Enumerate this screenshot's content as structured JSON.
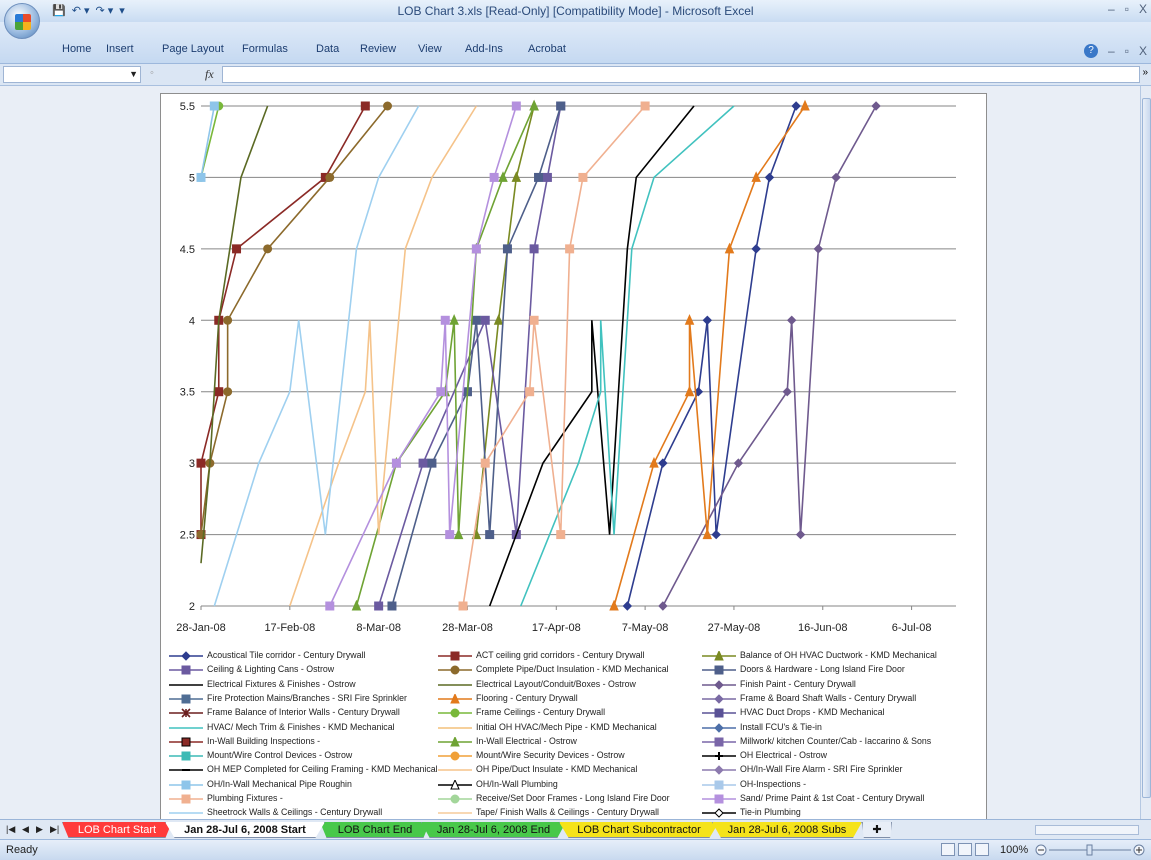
{
  "window": {
    "title": "LOB Chart 3.xls  [Read-Only]  [Compatibility Mode] - Microsoft Excel",
    "controls": [
      "–",
      "▫",
      "X"
    ]
  },
  "quick_access": {
    "save_icon": "save-icon",
    "undo_icon": "undo-icon",
    "redo_icon": "redo-icon"
  },
  "ribbon": {
    "tabs": [
      "Home",
      "Insert",
      "Page Layout",
      "Formulas",
      "Data",
      "Review",
      "View",
      "Add-Ins",
      "Acrobat"
    ]
  },
  "formula_bar": {
    "name_box": "",
    "fx": "fx",
    "formula": ""
  },
  "chart_data": {
    "type": "line",
    "x_axis_type": "date",
    "x_ticks": [
      "28-Jan-08",
      "17-Feb-08",
      "8-Mar-08",
      "28-Mar-08",
      "17-Apr-08",
      "7-May-08",
      "27-May-08",
      "16-Jun-08",
      "6-Jul-08"
    ],
    "y_ticks": [
      "2",
      "2.5",
      "3",
      "3.5",
      "4",
      "4.5",
      "5",
      "5.5"
    ],
    "ylim": [
      2,
      5.5
    ],
    "grid": "horizontal",
    "legend_position": "bottom",
    "series": [
      {
        "name": "Acoustical Tile corridor - Century Drywall",
        "color": "#2e3d8f",
        "marker": "diamond",
        "points": [
          [
            "2008-05-03",
            2
          ],
          [
            "2008-05-11",
            3
          ],
          [
            "2008-05-19",
            3.5
          ],
          [
            "2008-05-21",
            4
          ],
          [
            "2008-05-23",
            2.5
          ],
          [
            "2008-06-01",
            4.5
          ],
          [
            "2008-06-04",
            5
          ],
          [
            "2008-06-10",
            5.5
          ]
        ]
      },
      {
        "name": "ACT ceiling grid corridors - Century Drywall",
        "color": "#8b2a26",
        "marker": "square",
        "points": [
          [
            "2008-01-28",
            2.5
          ],
          [
            "2008-01-28",
            3
          ],
          [
            "2008-02-01",
            3.5
          ],
          [
            "2008-02-01",
            4
          ],
          [
            "2008-02-05",
            4.5
          ],
          [
            "2008-02-25",
            5
          ],
          [
            "2008-03-05",
            5.5
          ]
        ]
      },
      {
        "name": "Balance of OH HVAC Ductwork - KMD Mechanical",
        "color": "#7a8a22",
        "marker": "triangle",
        "points": [
          [
            "2008-03-30",
            2.5
          ],
          [
            "2008-04-04",
            4
          ],
          [
            "2008-04-08",
            5
          ],
          [
            "2008-04-12",
            5.5
          ]
        ]
      },
      {
        "name": "Ceiling & Lighting Cans - Ostrow",
        "color": "#6b5aa0",
        "marker": "square",
        "points": [
          [
            "2008-03-08",
            2
          ],
          [
            "2008-03-18",
            3
          ],
          [
            "2008-04-01",
            4
          ],
          [
            "2008-04-08",
            2.5
          ],
          [
            "2008-04-12",
            4.5
          ],
          [
            "2008-04-15",
            5
          ],
          [
            "2008-04-18",
            5.5
          ]
        ]
      },
      {
        "name": "Complete Pipe/Duct Insulation - KMD Mechanical",
        "color": "#8c6a2c",
        "marker": "circle",
        "points": [
          [
            "2008-01-28",
            2.5
          ],
          [
            "2008-01-30",
            3
          ],
          [
            "2008-02-03",
            3.5
          ],
          [
            "2008-02-03",
            4
          ],
          [
            "2008-02-12",
            4.5
          ],
          [
            "2008-02-26",
            5
          ],
          [
            "2008-03-10",
            5.5
          ]
        ]
      },
      {
        "name": "Doors & Hardware - Long Island Fire Door",
        "color": "#4e5f8a",
        "marker": "square",
        "points": [
          [
            "2008-03-11",
            2
          ],
          [
            "2008-03-20",
            3
          ],
          [
            "2008-03-28",
            3.5
          ],
          [
            "2008-03-30",
            4
          ],
          [
            "2008-04-02",
            2.5
          ],
          [
            "2008-04-06",
            4.5
          ],
          [
            "2008-04-13",
            5
          ],
          [
            "2008-04-18",
            5.5
          ]
        ]
      },
      {
        "name": "Electrical Fixtures & Finishes - Ostrow",
        "color": "#000000",
        "marker": "none",
        "points": [
          [
            "2008-04-02",
            2
          ],
          [
            "2008-04-14",
            3
          ],
          [
            "2008-04-25",
            3.5
          ],
          [
            "2008-04-25",
            4
          ],
          [
            "2008-04-29",
            2.5
          ],
          [
            "2008-05-03",
            4.5
          ],
          [
            "2008-05-05",
            5
          ],
          [
            "2008-05-18",
            5.5
          ]
        ]
      },
      {
        "name": "Electrical Layout/Conduit/Boxes - Ostrow",
        "color": "#5b6a24",
        "marker": "none",
        "points": [
          [
            "2008-01-28",
            2.3
          ],
          [
            "2008-01-30",
            3
          ],
          [
            "2008-02-01",
            4
          ],
          [
            "2008-02-06",
            5
          ],
          [
            "2008-02-12",
            5.5
          ]
        ]
      },
      {
        "name": "Finish Paint - Century Drywall",
        "color": "#6f5a8e",
        "marker": "diamond",
        "points": [
          [
            "2008-05-11",
            2
          ],
          [
            "2008-05-28",
            3
          ],
          [
            "2008-06-08",
            3.5
          ],
          [
            "2008-06-09",
            4
          ],
          [
            "2008-06-11",
            2.5
          ],
          [
            "2008-06-15",
            4.5
          ],
          [
            "2008-06-19",
            5
          ],
          [
            "2008-06-28",
            5.5
          ]
        ]
      },
      {
        "name": "Fire Protection Mains/Branches - SRI Fire Sprinkler",
        "color": "#4f6d94",
        "marker": "square",
        "points": []
      },
      {
        "name": "Flooring - Century Drywall",
        "color": "#e27a1c",
        "marker": "triangle",
        "points": [
          [
            "2008-04-30",
            2
          ],
          [
            "2008-05-09",
            3
          ],
          [
            "2008-05-17",
            3.5
          ],
          [
            "2008-05-17",
            4
          ],
          [
            "2008-05-21",
            2.5
          ],
          [
            "2008-05-26",
            4.5
          ],
          [
            "2008-06-01",
            5
          ],
          [
            "2008-06-12",
            5.5
          ]
        ]
      },
      {
        "name": "Frame & Board Shaft Walls - Century Drywall",
        "color": "#7a6aa4",
        "marker": "diamond",
        "points": []
      },
      {
        "name": "Frame Balance of Interior Walls - Century Drywall",
        "color": "#6b1f1f",
        "marker": "asterisk",
        "points": []
      },
      {
        "name": "Frame Ceilings - Century Drywall",
        "color": "#79b83a",
        "marker": "circle",
        "points": [
          [
            "2008-01-28",
            5
          ],
          [
            "2008-02-01",
            5.5
          ]
        ]
      },
      {
        "name": "HVAC Duct Drops - KMD Mechanical",
        "color": "#5a5296",
        "marker": "square",
        "points": []
      },
      {
        "name": "HVAC/ Mech Trim & Finishes - KMD Mechanical",
        "color": "#41c2bf",
        "marker": "none",
        "points": [
          [
            "2008-04-09",
            2
          ],
          [
            "2008-04-22",
            3
          ],
          [
            "2008-04-27",
            3.5
          ],
          [
            "2008-04-27",
            4
          ],
          [
            "2008-04-30",
            2.5
          ],
          [
            "2008-05-04",
            4.5
          ],
          [
            "2008-05-09",
            5
          ],
          [
            "2008-05-27",
            5.5
          ]
        ]
      },
      {
        "name": "Initial OH HVAC/Mech Pipe - KMD Mechanical",
        "color": "#f4c07a",
        "marker": "none",
        "points": []
      },
      {
        "name": "Install FCU's & Tie-in",
        "color": "#4d6fa8",
        "marker": "diamond",
        "points": []
      },
      {
        "name": "In-Wall Building Inspections -",
        "color": "#8b2a26",
        "marker": "square-open",
        "points": []
      },
      {
        "name": "In-Wall Electrical - Ostrow",
        "color": "#6fa334",
        "marker": "triangle",
        "points": [
          [
            "2008-03-03",
            2
          ],
          [
            "2008-03-12",
            3
          ],
          [
            "2008-03-23",
            3.5
          ],
          [
            "2008-03-25",
            4
          ],
          [
            "2008-03-26",
            2.5
          ],
          [
            "2008-03-30",
            4.5
          ],
          [
            "2008-04-05",
            5
          ],
          [
            "2008-04-12",
            5.5
          ]
        ]
      },
      {
        "name": "Millwork/ kitchen Counter/Cab - Iaccarino & Sons",
        "color": "#7a66a8",
        "marker": "square",
        "points": []
      },
      {
        "name": "Mount/Wire Control Devices - Ostrow",
        "color": "#3cbab5",
        "marker": "square",
        "points": []
      },
      {
        "name": "Mount/Wire Security Devices - Ostrow",
        "color": "#f0a038",
        "marker": "circle",
        "points": []
      },
      {
        "name": "OH Electrical - Ostrow",
        "color": "#000000",
        "marker": "plus",
        "points": []
      },
      {
        "name": "OH MEP Completed for Ceiling Framing - KMD Mechanical",
        "color": "#000000",
        "marker": "dash",
        "points": []
      },
      {
        "name": "OH Pipe/Duct Insulate - KMD Mechanical",
        "color": "#f5c38a",
        "marker": "none",
        "points": [
          [
            "2008-02-17",
            2
          ],
          [
            "2008-02-28",
            3
          ],
          [
            "2008-03-05",
            3.5
          ],
          [
            "2008-03-06",
            4
          ],
          [
            "2008-03-08",
            2.5
          ],
          [
            "2008-03-14",
            4.5
          ],
          [
            "2008-03-20",
            5
          ],
          [
            "2008-03-30",
            5.5
          ]
        ]
      },
      {
        "name": "OH/In-Wall Fire Alarm - SRI Fire Sprinkler",
        "color": "#8c7aae",
        "marker": "diamond",
        "points": []
      },
      {
        "name": "OH/In-Wall Mechanical Pipe Roughin",
        "color": "#8ec5ea",
        "marker": "square",
        "points": [
          [
            "2008-01-28",
            5
          ],
          [
            "2008-01-31",
            5.5
          ]
        ]
      },
      {
        "name": "OH/In-Wall Plumbing",
        "color": "#000000",
        "marker": "triangle-open",
        "points": []
      },
      {
        "name": "OH-Inspections -",
        "color": "#a9c9ea",
        "marker": "square",
        "points": []
      },
      {
        "name": "Plumbing Fixtures -",
        "color": "#f0b090",
        "marker": "square",
        "points": [
          [
            "2008-03-27",
            2
          ],
          [
            "2008-04-01",
            3
          ],
          [
            "2008-04-11",
            3.5
          ],
          [
            "2008-04-12",
            4
          ],
          [
            "2008-04-18",
            2.5
          ],
          [
            "2008-04-20",
            4.5
          ],
          [
            "2008-04-23",
            5
          ],
          [
            "2008-05-07",
            5.5
          ]
        ]
      },
      {
        "name": "Receive/Set Door Frames - Long Island Fire Door",
        "color": "#a3d69a",
        "marker": "circle",
        "points": []
      },
      {
        "name": "Sand/ Prime Paint & 1st Coat - Century Drywall",
        "color": "#b490de",
        "marker": "square",
        "points": [
          [
            "2008-02-26",
            2
          ],
          [
            "2008-03-12",
            3
          ],
          [
            "2008-03-22",
            3.5
          ],
          [
            "2008-03-23",
            4
          ],
          [
            "2008-03-24",
            2.5
          ],
          [
            "2008-03-30",
            4.5
          ],
          [
            "2008-04-03",
            5
          ],
          [
            "2008-04-08",
            5.5
          ]
        ]
      },
      {
        "name": "Sheetrock Walls & Ceilings - Century Drywall",
        "color": "#9fd0f0",
        "marker": "none",
        "points": [
          [
            "2008-01-31",
            2
          ],
          [
            "2008-02-10",
            3
          ],
          [
            "2008-02-17",
            3.5
          ],
          [
            "2008-02-19",
            4
          ],
          [
            "2008-02-25",
            2.5
          ],
          [
            "2008-03-03",
            4.5
          ],
          [
            "2008-03-08",
            5
          ],
          [
            "2008-03-17",
            5.5
          ]
        ]
      },
      {
        "name": "Tape/ Finish Walls & Ceilings - Century Drywall",
        "color": "#f6cc9a",
        "marker": "none",
        "points": []
      },
      {
        "name": "Tie-in Plumbing",
        "color": "#000000",
        "marker": "diamond-open",
        "points": []
      }
    ]
  },
  "sheet_tabs": [
    {
      "label": "LOB Chart Start",
      "color": "#ff3b3b"
    },
    {
      "label": "Jan 28-Jul 6, 2008 Start",
      "color": "#ffffff",
      "active": true
    },
    {
      "label": "LOB Chart End",
      "color": "#48c84a"
    },
    {
      "label": "Jan 28-Jul 6, 2008 End",
      "color": "#48c84a"
    },
    {
      "label": "LOB Chart Subcontractor",
      "color": "#f5e31a"
    },
    {
      "label": "Jan 28-Jul 6, 2008 Subs",
      "color": "#f5e31a"
    }
  ],
  "status": {
    "text": "Ready",
    "zoom": "100%"
  }
}
